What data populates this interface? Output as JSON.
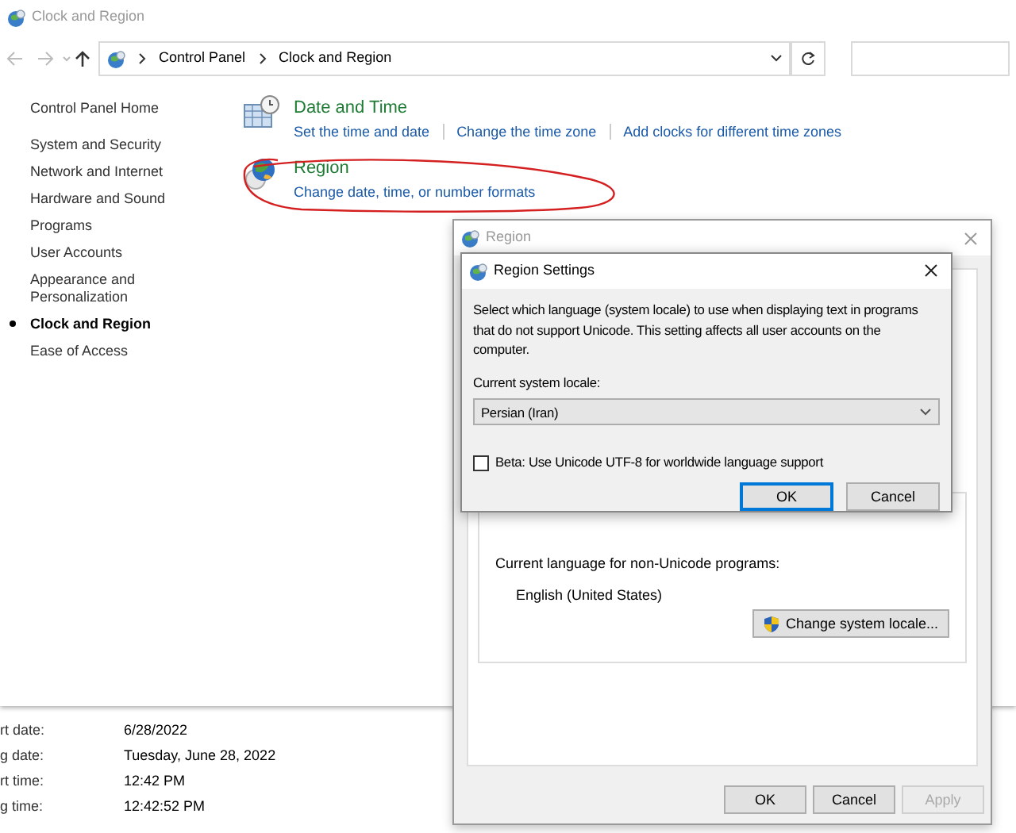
{
  "control_panel": {
    "title": "Clock and Region",
    "breadcrumb": [
      "Control Panel",
      "Clock and Region"
    ],
    "sidebar": [
      {
        "label": "Control Panel Home",
        "selected": false
      },
      {
        "label": "System and Security",
        "selected": false
      },
      {
        "label": "Network and Internet",
        "selected": false
      },
      {
        "label": "Hardware and Sound",
        "selected": false
      },
      {
        "label": "Programs",
        "selected": false
      },
      {
        "label": "User Accounts",
        "selected": false
      },
      {
        "label": "Appearance and Personalization",
        "selected": false
      },
      {
        "label": "Clock and Region",
        "selected": true
      },
      {
        "label": "Ease of Access",
        "selected": false
      }
    ],
    "categories": [
      {
        "kind": "datetime",
        "heading": "Date and Time",
        "links": [
          "Set the time and date",
          "Change the time zone",
          "Add clocks for different time zones"
        ]
      },
      {
        "kind": "region",
        "heading": "Region",
        "links": [
          "Change date, time, or number formats"
        ]
      }
    ]
  },
  "formats_window": {
    "rows": [
      {
        "label": "rt date:",
        "value": "6/28/2022"
      },
      {
        "label": "g date:",
        "value": "Tuesday, June 28, 2022"
      },
      {
        "label": "rt time:",
        "value": "12:42 PM"
      },
      {
        "label": "g time:",
        "value": "12:42:52 PM"
      }
    ]
  },
  "region_window": {
    "title": "Region",
    "group_label": "Current language for non-Unicode programs:",
    "current_language": "English (United States)",
    "change_button": "Change system locale...",
    "buttons": [
      {
        "label": "OK",
        "disabled": false
      },
      {
        "label": "Cancel",
        "disabled": false
      },
      {
        "label": "Apply",
        "disabled": true
      }
    ]
  },
  "region_settings_dialog": {
    "title": "Region Settings",
    "description": "Select which language (system locale) to use when displaying text in programs that do not support Unicode. This setting affects all user accounts on the computer.",
    "locale_label": "Current system locale:",
    "locale_value": "Persian (Iran)",
    "beta_option": {
      "label": "Beta: Use Unicode UTF-8 for worldwide language support",
      "checked": false
    },
    "buttons": [
      {
        "label": "OK",
        "default": true
      },
      {
        "label": "Cancel",
        "default": false
      }
    ]
  }
}
